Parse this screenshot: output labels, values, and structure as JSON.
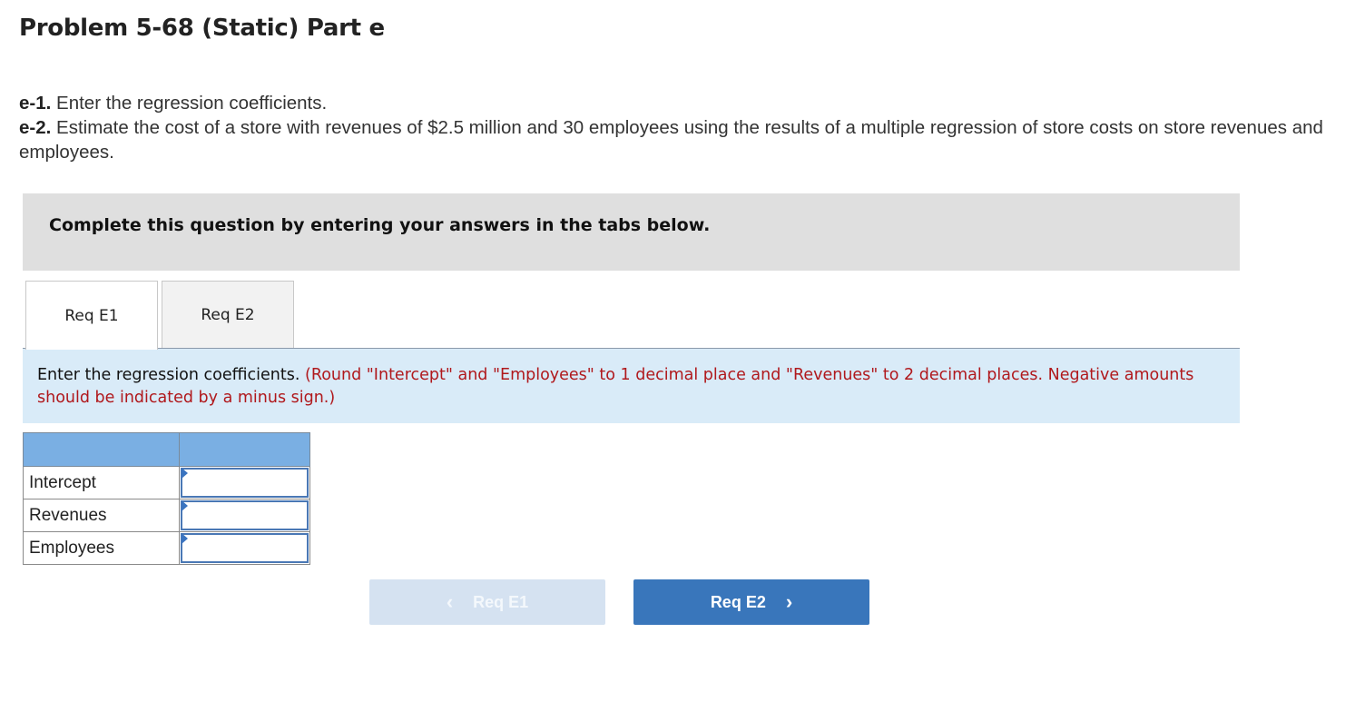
{
  "page": {
    "title": "Problem 5-68 (Static) Part e"
  },
  "instructions": [
    {
      "label": "e-1.",
      "text": " Enter the regression coefficients."
    },
    {
      "label": "e-2.",
      "text": " Estimate the cost of a store with revenues of $2.5 million and 30 employees using the results of a multiple regression of store costs on store revenues and employees."
    }
  ],
  "banner": {
    "text": "Complete this question by entering your answers in the tabs below."
  },
  "tabs": [
    {
      "label": "Req E1",
      "active": true
    },
    {
      "label": "Req E2",
      "active": false
    }
  ],
  "prompt": {
    "text": "Enter the regression coefficients. ",
    "note": "(Round \"Intercept\" and \"Employees\" to 1 decimal place and \"Revenues\" to 2 decimal places. Negative amounts should be indicated by a minus sign.)"
  },
  "table": {
    "headers": [
      "",
      ""
    ],
    "rows": [
      {
        "label": "Intercept",
        "value": ""
      },
      {
        "label": "Revenues",
        "value": ""
      },
      {
        "label": "Employees",
        "value": ""
      }
    ]
  },
  "navigation": {
    "prev_label": "Req E1",
    "prev_icon": "chevron-left-icon",
    "prev_glyph": "‹",
    "prev_disabled": true,
    "next_label": "Req E2",
    "next_icon": "chevron-right-icon",
    "next_glyph": "›"
  },
  "colors": {
    "banner_bg": "#dfdfdf",
    "prompt_bg": "#d9ebf8",
    "note_red": "#b0181c",
    "table_header_bg": "#7aafe3",
    "next_button_bg": "#3976bb",
    "prev_button_bg_disabled": "#d5e2f1"
  }
}
